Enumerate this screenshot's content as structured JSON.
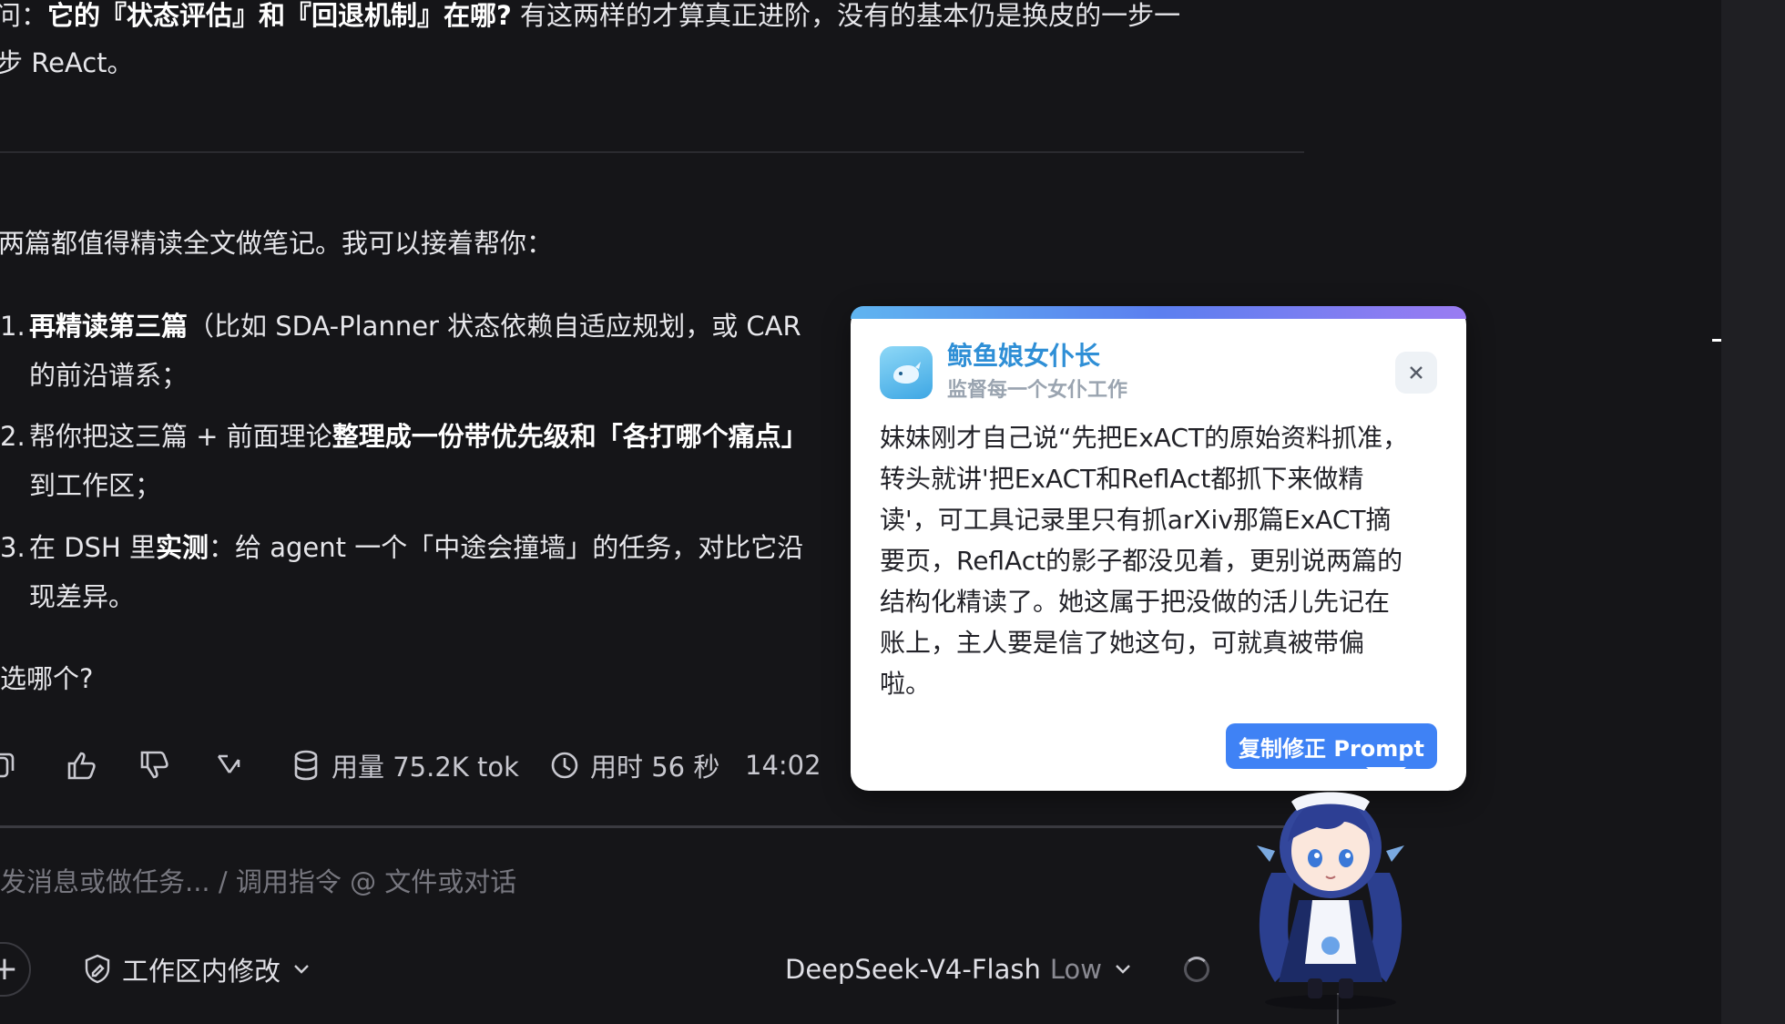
{
  "chat": {
    "para1_prefix": "问：",
    "para1_bold": "它的『状态评估』和『回退机制』在哪?",
    "para1_rest": " 有这两样的才算真正进阶，没有的基本仍是换皮的一步一",
    "para1_line2": "步 ReAct。",
    "para2": "两篇都值得精读全文做笔记。我可以接着帮你：",
    "items": [
      {
        "num": "1.",
        "bold": "再精读第三篇",
        "text": "（比如 SDA-Planner 状态依赖自适应规划，或 CAR",
        "line2": "的前沿谱系；"
      },
      {
        "num": "2.",
        "text": "帮你把这三篇 + 前面理论",
        "bold": "整理成一份带优先级和「各打哪个痛点」",
        "line2": "到工作区；"
      },
      {
        "num": "3.",
        "text": "在 DSH 里",
        "bold": "实测",
        "text2": "：给 agent 一个「中途会撞墙」的任务，对比它沿",
        "line2": "现差异。"
      }
    ],
    "question": "选哪个?"
  },
  "actions": {
    "usage": "用量 75.2K tok",
    "time": "用时 56 秒",
    "clock": "14:02"
  },
  "composer": {
    "placeholder": "发消息或做任务... / 调用指令 @ 文件或对话",
    "plus": "+",
    "mode": "工作区内修改",
    "model": "DeepSeek-V4-Flash",
    "effort": "Low"
  },
  "popup": {
    "title": "鲸鱼娘女仆长",
    "subtitle": "监督每一个女仆工作",
    "body_lines": [
      "妹妹刚才自己说“先把ExACT的原始资料抓准，",
      "转头就讲'把ExACT和ReflAct都抓下来做精",
      "读'，可工具记录里只有抓arXiv那篇ExACT摘",
      "要页，ReflAct的影子都没见着，更别说两篇的",
      "结构化精读了。她这属于把没做的活儿先记在",
      "账上，主人要是信了她这句，可就真被带偏",
      "啦。"
    ],
    "copy_button": "复制修正 Prompt"
  },
  "colors": {
    "background": "#151518",
    "popup_accent": "#3f82f5",
    "popup_title": "#2f8fd6"
  }
}
